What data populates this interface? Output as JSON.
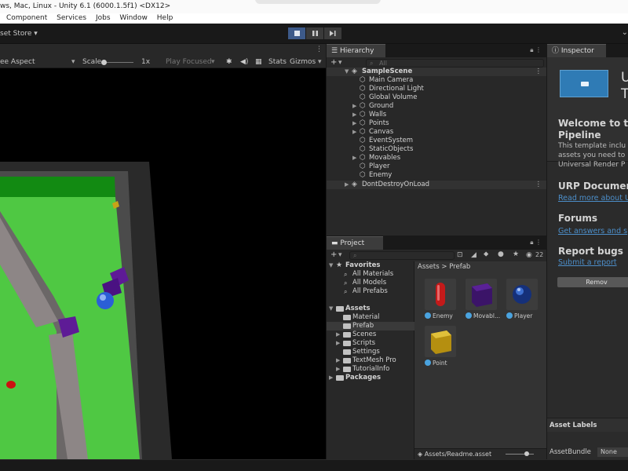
{
  "window": {
    "title": "ws, Mac, Linux - Unity 6.1 (6000.1.5f1) <DX12>"
  },
  "menu": [
    "Component",
    "Services",
    "Jobs",
    "Window",
    "Help"
  ],
  "toolbar": {
    "asset_store": "set Store",
    "right_icon": "⌄"
  },
  "game_view": {
    "aspect": "ee Aspect",
    "scale_label": "Scale",
    "scale_value": "1x",
    "play_mode": "Play Focused",
    "stats": "Stats",
    "gizmos": "Gizmos"
  },
  "hierarchy": {
    "tab": "Hierarchy",
    "search_placeholder": "All",
    "scene": "SampleScene",
    "items": [
      "Main Camera",
      "Directional Light",
      "Global Volume",
      "Ground",
      "Walls",
      "Points",
      "Canvas",
      "EventSystem",
      "StaticObjects",
      "Movables",
      "Player",
      "Enemy"
    ],
    "dont_destroy": "DontDestroyOnLoad"
  },
  "project": {
    "tab": "Project",
    "hidden_count": "22",
    "favorites": "Favorites",
    "favorites_items": [
      "All Materials",
      "All Models",
      "All Prefabs"
    ],
    "assets": "Assets",
    "assets_items": [
      "Material",
      "Prefab",
      "Scenes",
      "Scripts",
      "Settings",
      "TextMesh Pro",
      "TutorialInfo"
    ],
    "packages": "Packages",
    "breadcrumb_root": "Assets",
    "breadcrumb_sep": ">",
    "breadcrumb_current": "Prefab",
    "grid": [
      "Enemy",
      "Movabl...",
      "Player",
      "Point"
    ],
    "path": "Assets/Readme.asset"
  },
  "inspector": {
    "tab": "Inspector",
    "header_letter_1": "U",
    "header_letter_2": "T",
    "welcome_title_1": "Welcome to the",
    "welcome_title_2": "Pipeline",
    "welcome_body_1": "This template inclu",
    "welcome_body_2": "assets you need to",
    "welcome_body_3": "Universal Render P",
    "docs_title": "URP Document",
    "docs_link": "Read more about U",
    "forums_title": "Forums",
    "forums_link": "Get answers and s",
    "bugs_title": "Report bugs",
    "bugs_link": "Submit a report",
    "remove_button": "Remov",
    "asset_labels": "Asset Labels",
    "asset_bundle": "AssetBundle",
    "asset_bundle_value": "None"
  }
}
